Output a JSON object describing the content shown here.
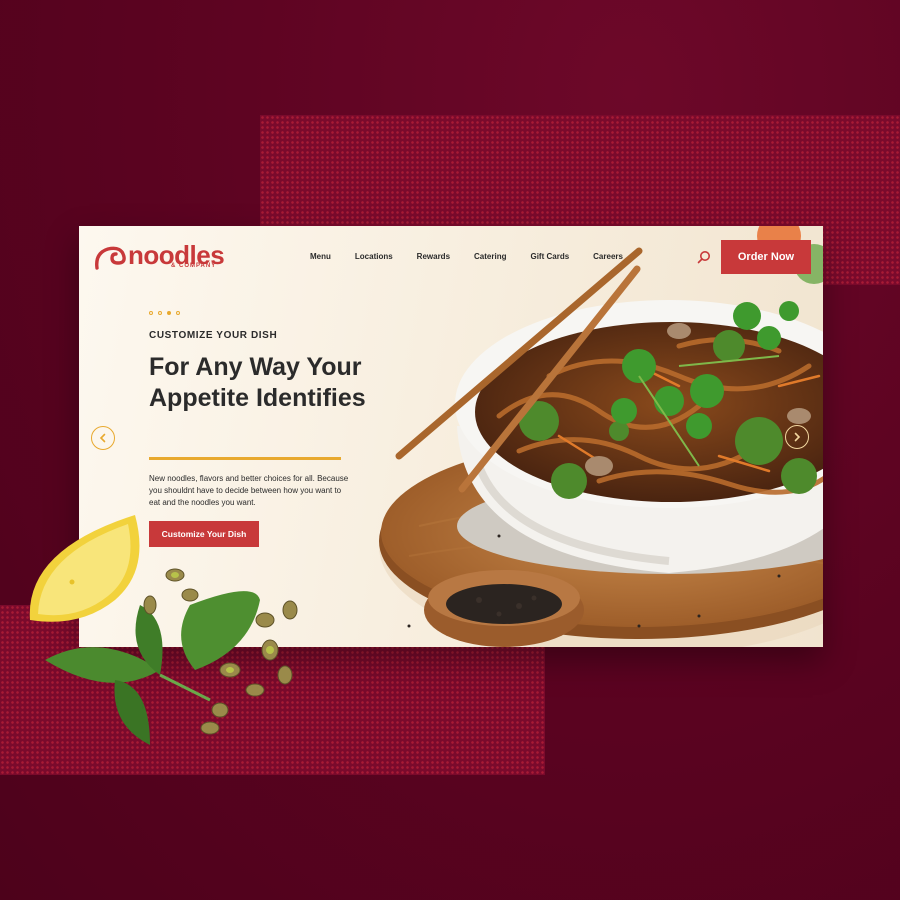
{
  "brand": {
    "name": "noodles",
    "tagline": "& COMPANY",
    "color": "#c8393a",
    "accent": "#e8a92e"
  },
  "nav": {
    "items": [
      "Menu",
      "Locations",
      "Rewards",
      "Catering",
      "Gift Cards",
      "Careers"
    ],
    "search_icon": "search-icon",
    "order_label": "Order Now"
  },
  "hero": {
    "slide_count": 4,
    "active_slide": 3,
    "eyebrow": "CUSTOMIZE YOUR DISH",
    "headline": "For Any Way Your Appetite Identifies",
    "description": "New noodles, flavors and better choices for all. Because you shouldnt have to decide between how you want to eat and the noodles you want.",
    "cta_label": "Customize Your Dish",
    "prev_icon": "chevron-left-icon",
    "next_icon": "chevron-right-icon"
  }
}
